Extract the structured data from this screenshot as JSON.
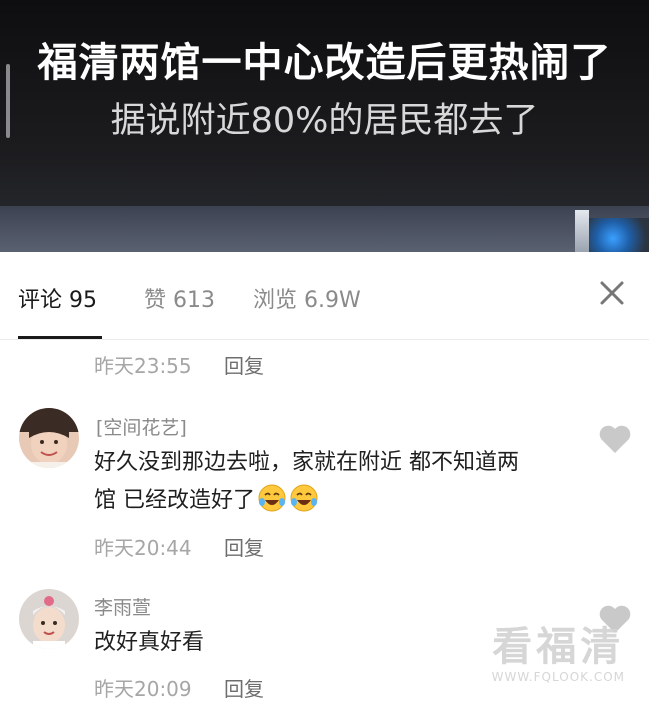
{
  "video": {
    "title": "福清两馆一中心改造后更热闹了",
    "subtitle": "据说附近80%的居民都去了"
  },
  "tabs": [
    {
      "label": "评论 95",
      "active": true
    },
    {
      "label": "赞 613",
      "active": false
    },
    {
      "label": "浏览 6.9W",
      "active": false
    }
  ],
  "comments_partial": {
    "time": "昨天23:55",
    "reply": "回复"
  },
  "comments": [
    {
      "username": "[空间花艺]",
      "text_line1": "好久没到那边去啦，家就在附近 都不知道两",
      "text_line2": "馆 已经改造好了",
      "emoji": "rofl-emoji",
      "time": "昨天20:44",
      "reply": "回复"
    },
    {
      "username": "李雨萱",
      "text_line1": "改好真好看",
      "time": "昨天20:09",
      "reply": "回复"
    }
  ],
  "watermark": {
    "main": "看福清",
    "url": "WWW.FQLOOK.COM"
  },
  "colors": {
    "accent": "#1a1a1a",
    "muted": "#8a8a8a",
    "heart": "#c9c9c9",
    "emoji_yellow": "#ffc83d"
  }
}
